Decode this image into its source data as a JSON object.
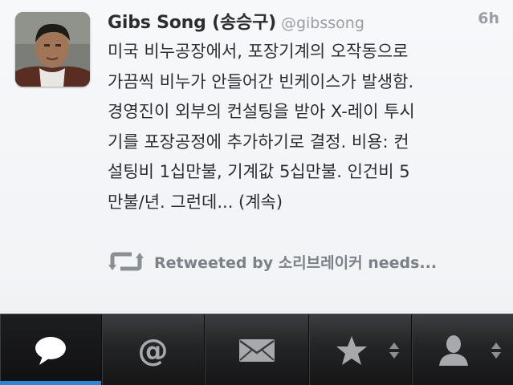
{
  "tweet": {
    "name": "Gibs Song (송승구)",
    "handle": "@gibssong",
    "time": "6h",
    "lines": [
      "미국 비누공장에서, 포장기계의 오작동으로",
      "가끔씩 비누가 안들어간 빈케이스가 발생함.",
      "경영진이 외부의 컨설팅을 받아 X-레이 투시",
      "기를 포장공정에 추가하기로 결정. 비용: 컨",
      "설팅비 1십만불, 기계값 5십만불. 인건비 5",
      "만불/년. 그런데... (계속)"
    ],
    "retweet_label": "Retweeted by 소리브레이커 needs..."
  },
  "tabbar": {
    "tabs": [
      {
        "icon": "speech-bubble-icon",
        "active": true
      },
      {
        "icon": "at-sign-icon",
        "active": false
      },
      {
        "icon": "envelope-icon",
        "active": false
      },
      {
        "icon": "star-icon",
        "active": false,
        "has_sort": true
      },
      {
        "icon": "person-icon",
        "active": false,
        "has_sort": true
      }
    ],
    "at_glyph": "@",
    "accent_color": "#2a86d6"
  }
}
